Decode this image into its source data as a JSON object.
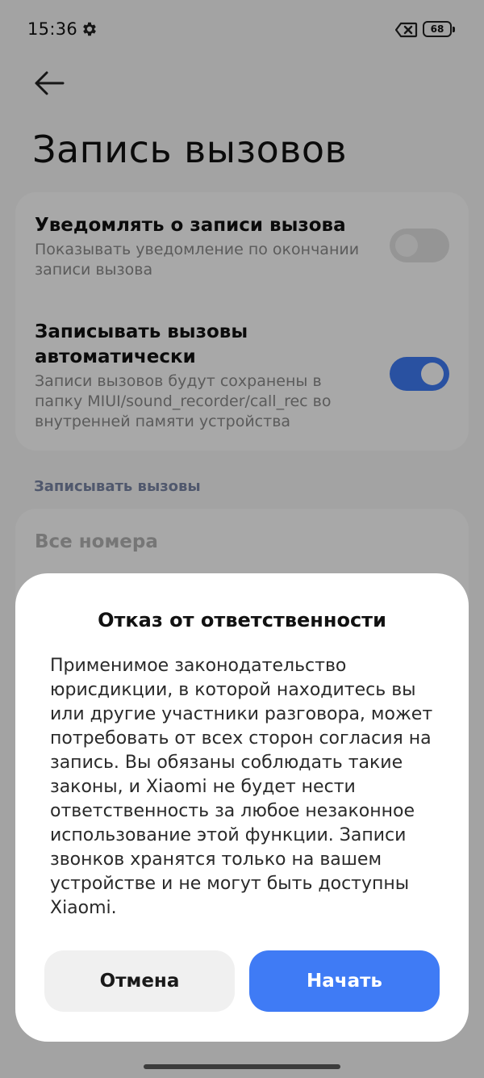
{
  "status_bar": {
    "time": "15:36",
    "battery": "68",
    "icons": [
      "gear-icon",
      "sim-x-icon",
      "battery-icon"
    ]
  },
  "header": {
    "back_icon": "arrow-left-icon",
    "title": "Запись вызовов"
  },
  "settings": {
    "notify": {
      "title": "Уведомлять о записи вызова",
      "subtitle": "Показывать уведомление по окончании записи вызова",
      "enabled": false
    },
    "auto_record": {
      "title": "Записывать вызовы автоматически",
      "subtitle": "Записи вызовов будут сохранены в папку MIUI/sound_recorder/call_rec во внутренней памяти устройства",
      "enabled": true
    }
  },
  "record_section": {
    "header": "Записывать вызовы",
    "option": "Все номера"
  },
  "dialog": {
    "title": "Отказ от ответственности",
    "body": "Применимое законодательство юрисдикции, в которой находитесь вы или другие участники разговора, может потребовать от всех сторон согласия на запись. Вы обязаны соблюдать такие законы, и Xiaomi не будет нести ответственность за любое незаконное использование этой функции. Записи звонков хранятся только на вашем устройстве и не могут быть доступны Xiaomi.",
    "cancel": "Отмена",
    "start": "Начать"
  },
  "colors": {
    "accent": "#3f7bf5",
    "section_header": "#7a86a6"
  }
}
